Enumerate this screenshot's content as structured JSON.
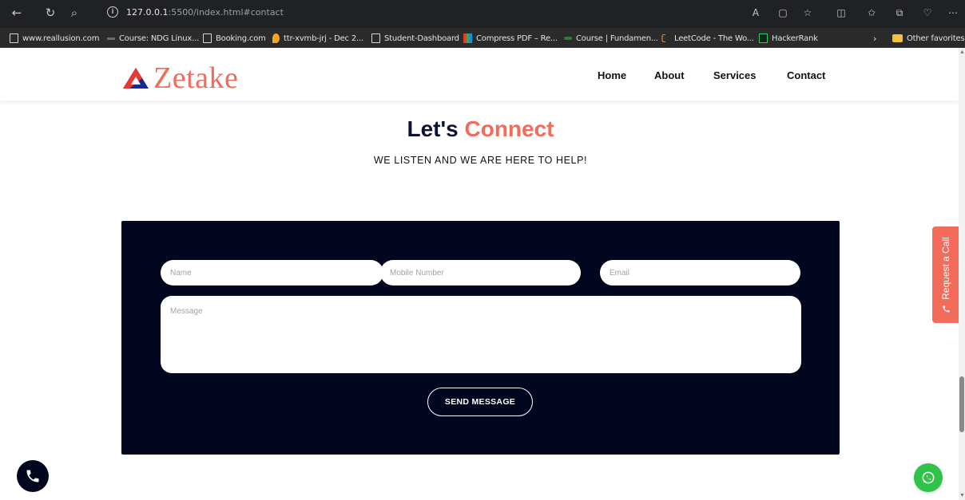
{
  "browser": {
    "url_host": "127.0.0.1",
    "url_rest": ":5500/index.html#contact",
    "bookmarks": [
      {
        "label": "www.reallusion.com",
        "icon": "page-icon"
      },
      {
        "label": "Course: NDG Linux...",
        "icon": "course-icon"
      },
      {
        "label": "Booking.com",
        "icon": "page-icon"
      },
      {
        "label": "ttr-xvmb-jrj - Dec 2...",
        "icon": "meet-icon"
      },
      {
        "label": "Student-Dashboard",
        "icon": "page-icon"
      },
      {
        "label": "Compress PDF – Re...",
        "icon": "pdf-icon"
      },
      {
        "label": "Course | Fundamen...",
        "icon": "course-icon"
      },
      {
        "label": "LeetCode - The Wo...",
        "icon": "leetcode-icon"
      },
      {
        "label": "HackerRank",
        "icon": "hackerrank-icon"
      }
    ],
    "other_favorites": "Other favorites"
  },
  "header": {
    "logo_text": "Zetake",
    "nav": [
      "Home",
      "About",
      "Services",
      "Contact"
    ]
  },
  "contact": {
    "title_part1": "Let's",
    "title_part2": "Connect",
    "subtitle": "WE LISTEN AND WE ARE HERE TO HELP!",
    "placeholders": {
      "name": "Name",
      "mobile": "Mobile Number",
      "email": "Email",
      "message": "Message"
    },
    "send_label": "SEND MESSAGE"
  },
  "request_call": {
    "label": "Request a Call"
  },
  "colors": {
    "accent": "#f26b5b",
    "panel": "#02061f",
    "whatsapp": "#2fc34a"
  }
}
